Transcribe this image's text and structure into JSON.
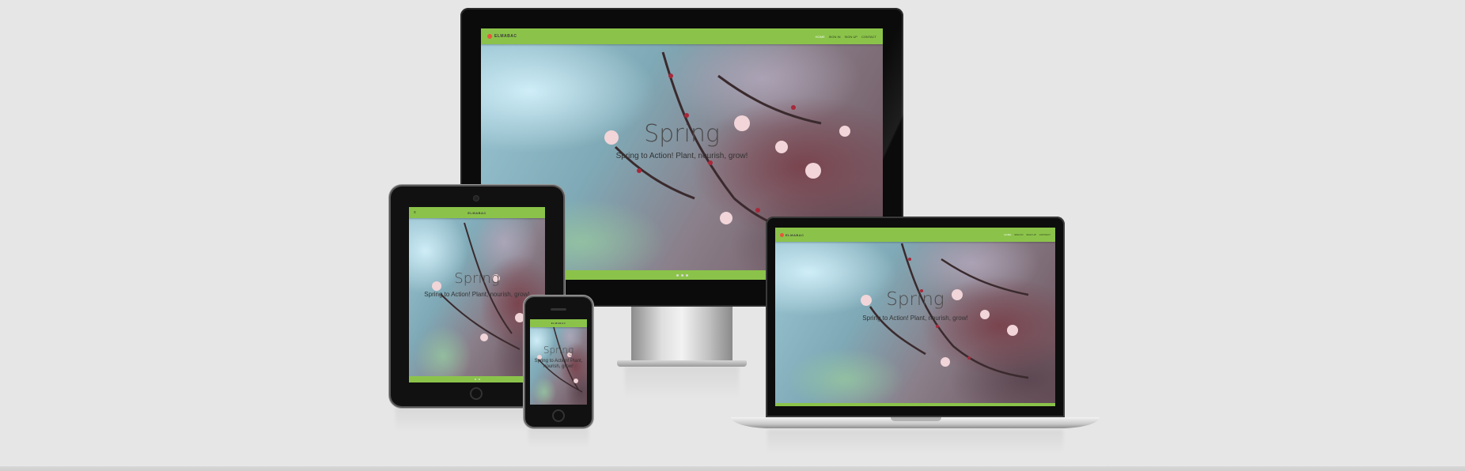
{
  "site": {
    "brand": "ELMABAC",
    "nav": [
      "HOME",
      "SIGN IN",
      "SIGN UP",
      "CONTACT"
    ],
    "active_nav": "HOME",
    "hero_title": "Spring",
    "hero_subtitle": "Spring to Action! Plant, nourish, grow!"
  },
  "colors": {
    "navbar": "#8bc34a",
    "logo_accent": "#e8553e",
    "background": "#e6e6e6"
  },
  "devices": [
    "desktop",
    "tablet",
    "phone",
    "laptop"
  ]
}
